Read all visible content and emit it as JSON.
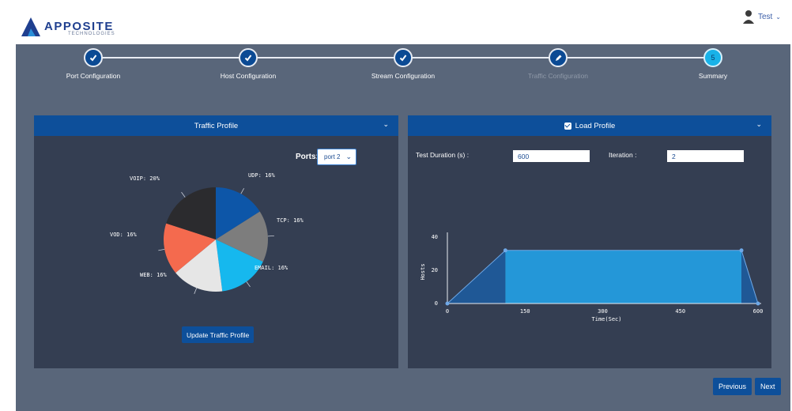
{
  "brand": {
    "name": "APPOSITE",
    "tagline": "TECHNOLOGIES"
  },
  "user": {
    "name": "Test"
  },
  "stepper": {
    "steps": [
      {
        "label": "Port Configuration",
        "status": "done"
      },
      {
        "label": "Host Configuration",
        "status": "done"
      },
      {
        "label": "Stream Configuration",
        "status": "done"
      },
      {
        "label": "Traffic Configuration",
        "status": "editing"
      },
      {
        "label": "Summary",
        "status": "current",
        "number": "5"
      }
    ]
  },
  "traffic_profile": {
    "title": "Traffic Profile",
    "ports_label": "Ports:",
    "ports_value": "port 2",
    "update_button": "Update Traffic Profile",
    "slices": [
      {
        "label": "UDP: 16%",
        "value": 16,
        "color": "#0d56a8"
      },
      {
        "label": "TCP: 16%",
        "value": 16,
        "color": "#7d7d7d"
      },
      {
        "label": "EMAIL: 16%",
        "value": 16,
        "color": "#16b8ee"
      },
      {
        "label": "WEB: 16%",
        "value": 16,
        "color": "#e6e6e6"
      },
      {
        "label": "VOD: 16%",
        "value": 16,
        "color": "#f46a4e"
      },
      {
        "label": "VOIP: 20%",
        "value": 20,
        "color": "#2b2b2e"
      }
    ]
  },
  "load_profile": {
    "title": "Load Profile",
    "duration_label": "Test Duration (s) :",
    "duration_value": "600",
    "iteration_label": "Iteration :",
    "iteration_value": "2",
    "chart_data": {
      "type": "area",
      "xlabel": "Time(Sec)",
      "ylabel": "Hosts",
      "x": [
        0,
        112,
        568,
        600
      ],
      "y": [
        0,
        32,
        32,
        0
      ],
      "xticks": [
        0,
        150,
        300,
        450,
        600
      ],
      "yticks": [
        0,
        20,
        40
      ],
      "xlim": [
        0,
        600
      ],
      "ylim": [
        0,
        40
      ],
      "colors": {
        "ramp": "#1f5896",
        "plateau": "#2497d8",
        "point": "#6fa9e8"
      }
    }
  },
  "nav": {
    "previous": "Previous",
    "next": "Next"
  },
  "colors": {
    "accent": "#0d4f9a",
    "current_step": "#18b2e8",
    "background": "#59667a",
    "panel": "#343e52"
  }
}
